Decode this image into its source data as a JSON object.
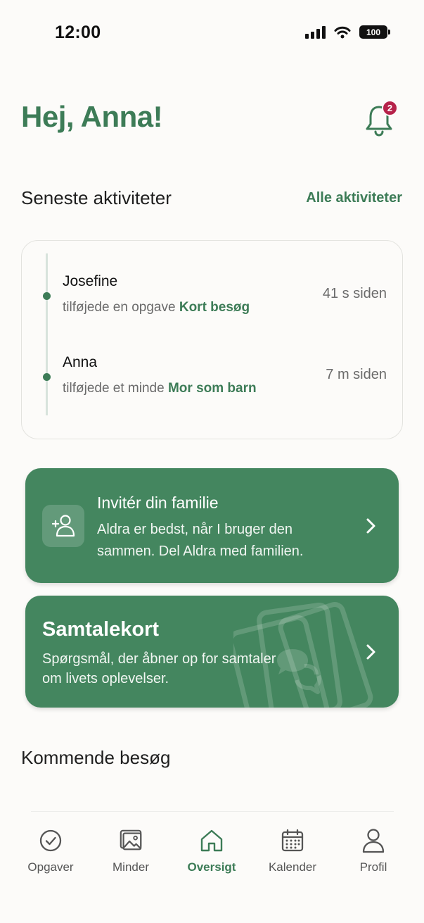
{
  "status_bar": {
    "time": "12:00",
    "battery": "100"
  },
  "header": {
    "greeting": "Hej, Anna!",
    "notification_count": "2"
  },
  "recent": {
    "title": "Seneste aktiviteter",
    "link": "Alle aktiviteter",
    "items": [
      {
        "name": "Josefine",
        "action": "tilføjede en opgave ",
        "target": "Kort besøg",
        "time": "41 s siden"
      },
      {
        "name": "Anna",
        "action": "tilføjede et minde ",
        "target": "Mor som barn",
        "time": "7 m siden"
      }
    ]
  },
  "invite": {
    "title": "Invitér din familie",
    "text": "Aldra er bedst, når I bruger den sammen. Del Aldra med familien."
  },
  "talk_cards": {
    "title": "Samtalekort",
    "text": "Spørgsmål, der åbner op for samtaler om livets oplevelser."
  },
  "upcoming": {
    "title": "Kommende besøg"
  },
  "nav": {
    "items": [
      {
        "label": "Opgaver",
        "icon": "check-circle-icon"
      },
      {
        "label": "Minder",
        "icon": "images-icon"
      },
      {
        "label": "Oversigt",
        "icon": "home-icon",
        "active": true
      },
      {
        "label": "Kalender",
        "icon": "calendar-icon"
      },
      {
        "label": "Profil",
        "icon": "user-icon"
      }
    ]
  },
  "colors": {
    "brand": "#3d7c57",
    "card": "#44865f",
    "badge": "#b6224a",
    "background": "#fcfbf9"
  }
}
